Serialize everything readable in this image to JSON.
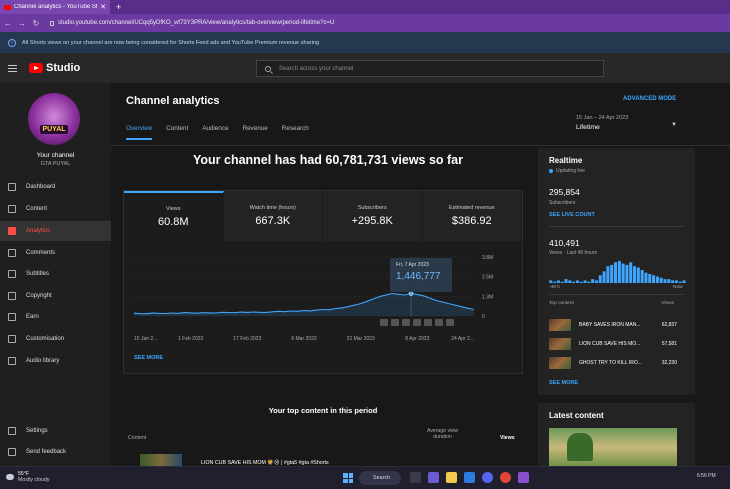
{
  "browser": {
    "tab_title": "Channel analytics - YouTube Studio",
    "url": "studio.youtube.com/channel/UCqq5yDfKO_wf73Y3PRA/view/analytics/tab-overview/period-lifetime?c=U"
  },
  "infobar": {
    "text": "All Shorts views on your channel are now being considered for Shorts Feed ads and YouTube Premium revenue sharing"
  },
  "header": {
    "logo_text": "Studio",
    "search_placeholder": "Search across your channel"
  },
  "sidebar": {
    "avatar_text": "PUYAL",
    "channel_label": "Your channel",
    "channel_name": "GTA PUYAL",
    "items": [
      {
        "label": "Dashboard",
        "icon": "dashboard-icon"
      },
      {
        "label": "Content",
        "icon": "content-icon"
      },
      {
        "label": "Analytics",
        "icon": "analytics-icon",
        "active": true
      },
      {
        "label": "Comments",
        "icon": "comments-icon"
      },
      {
        "label": "Subtitles",
        "icon": "subtitles-icon"
      },
      {
        "label": "Copyright",
        "icon": "copyright-icon"
      },
      {
        "label": "Earn",
        "icon": "earn-icon"
      },
      {
        "label": "Customisation",
        "icon": "customisation-icon"
      },
      {
        "label": "Audio library",
        "icon": "audio-library-icon"
      },
      {
        "label": "Settings",
        "icon": "settings-icon"
      },
      {
        "label": "Send feedback",
        "icon": "feedback-icon"
      }
    ]
  },
  "main": {
    "title": "Channel analytics",
    "tabs": [
      "Overview",
      "Content",
      "Audience",
      "Revenue",
      "Research"
    ],
    "advanced_mode": "ADVANCED MODE",
    "date_range": "15 Jan – 24 Apr 2023",
    "period": "Lifetime",
    "headline": "Your channel has had 60,781,731 views so far",
    "kpis": [
      {
        "label": "Views",
        "value": "60.8M"
      },
      {
        "label": "Watch time (hours)",
        "value": "667.3K"
      },
      {
        "label": "Subscribers",
        "value": "+295.8K"
      },
      {
        "label": "Estimated revenue",
        "value": "$386.92"
      }
    ],
    "tooltip": {
      "date": "Fri, 7 Apr 2023",
      "value": "1,446,777"
    },
    "see_more": "SEE MORE",
    "top_content": {
      "title": "Your top content in this period",
      "col_content": "Content",
      "col_avg": "Average view duration",
      "col_views": "Views",
      "rows": [
        {
          "title": "LION CUB SAVE HIS MOM 🦁😢 | #gta5 #gta #Shorts"
        }
      ]
    }
  },
  "chart_data": {
    "type": "line",
    "x_tick_labels": [
      "15 Jan 2...",
      "1 Feb 2023",
      "17 Feb 2023",
      "6 Mar 2023",
      "22 Mar 2023",
      "8 Apr 2023",
      "24 Apr 2..."
    ],
    "y_tick_labels": [
      "3.8M",
      "2.5M",
      "1.3M",
      "0"
    ],
    "ylim": [
      0,
      3800000
    ],
    "highlight": {
      "x": "7 Apr 2023",
      "y": 1446777
    },
    "series": [
      {
        "values": [
          180000,
          150000,
          140000,
          200000,
          170000,
          160000,
          190000,
          170000,
          220000,
          200000,
          180000,
          210000,
          200000,
          190000,
          240000,
          220000,
          210000,
          250000,
          230000,
          260000,
          240000,
          230000,
          270000,
          300000,
          280000,
          320000,
          300000,
          350000,
          330000,
          380000,
          420000,
          400000,
          480000,
          520000,
          600000,
          700000,
          800000,
          950000,
          1100000,
          1250000,
          1350000,
          1450000,
          1400000,
          1350000,
          1446777,
          1380000,
          1300000,
          1150000,
          1000000,
          900000,
          800000,
          700000,
          600000,
          500000,
          420000
        ]
      }
    ]
  },
  "realtime": {
    "title": "Realtime",
    "status": "Updating live",
    "subscribers": "295,854",
    "subscribers_label": "Subscribers",
    "live_count": "SEE LIVE COUNT",
    "views": "410,491",
    "views_label": "Views · Last 48 hours",
    "axis_left": "-48 h",
    "axis_right": "Now",
    "top_content_label": "Top content",
    "views_col": "Views",
    "items": [
      {
        "title": "BABY SAVES IRON MAN...",
        "views": "62,837"
      },
      {
        "title": "LION CUB SAVE HIS MO...",
        "views": "57,581"
      },
      {
        "title": "GHOST TRY TO KILL IRO...",
        "views": "32,230"
      }
    ],
    "see_more": "SEE MORE",
    "bars": [
      2,
      1,
      2,
      1,
      3,
      2,
      1,
      2,
      1,
      2,
      1,
      3,
      2,
      6,
      9,
      13,
      14,
      16,
      17,
      15,
      14,
      16,
      13,
      12,
      10,
      8,
      7,
      6,
      5,
      4,
      3,
      3,
      2,
      2,
      1,
      2
    ]
  },
  "latest_content": {
    "title": "Latest content"
  },
  "taskbar": {
    "temp": "55°F",
    "weather": "Mostly cloudy",
    "search": "Search",
    "time": "6:56 PM"
  }
}
